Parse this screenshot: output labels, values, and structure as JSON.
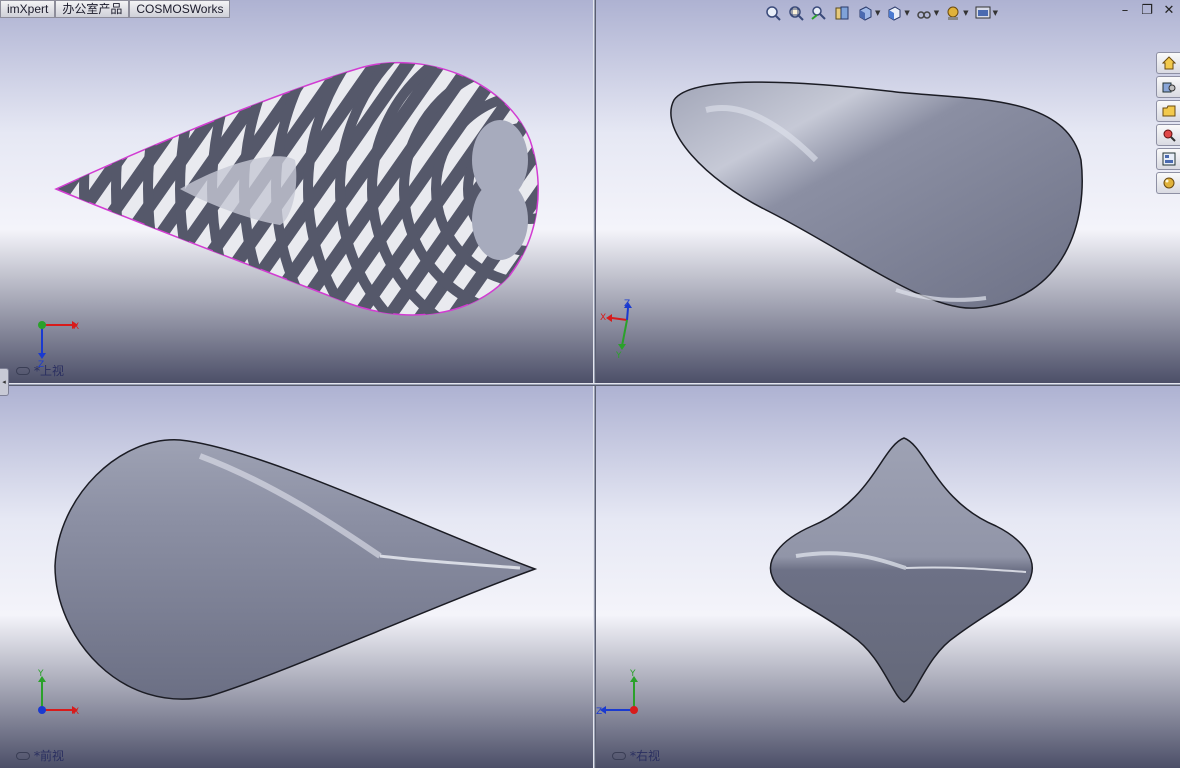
{
  "tabs": [
    "imXpert",
    "办公室产品",
    "COSMOSWorks"
  ],
  "viewports": {
    "top": {
      "label": "*上视"
    },
    "iso": {
      "label": ""
    },
    "front": {
      "label": "*前视"
    },
    "right": {
      "label": "*右视"
    }
  },
  "triads": {
    "top": {
      "x": "X",
      "y": "Z"
    },
    "iso": {
      "x": "X",
      "y": "Y",
      "z": "Z"
    },
    "front": {
      "x": "X",
      "y": "Y"
    },
    "right": {
      "x": "Z",
      "y": "Y"
    }
  },
  "toolbar_icons": [
    "zoom-to-fit-icon",
    "zoom-area-icon",
    "previous-view-icon",
    "section-view-icon",
    "view-orientation-icon",
    "display-style-icon",
    "hide-show-icon",
    "appearance-icon",
    "scene-icon"
  ],
  "window_controls": {
    "minimize": "–",
    "restore": "❐",
    "close": "✕"
  },
  "taskpane_icons": [
    "home-icon",
    "design-library-icon",
    "file-explorer-icon",
    "search-icon",
    "view-palette-icon",
    "appearances-icon"
  ],
  "colors": {
    "viewport_top": "#e8e9f4",
    "viewport_bottom": "#4e5068",
    "model": "#7a7e92",
    "accent_x": "#d81b1b",
    "accent_y": "#2aa12a",
    "accent_z": "#1a3ad0"
  }
}
